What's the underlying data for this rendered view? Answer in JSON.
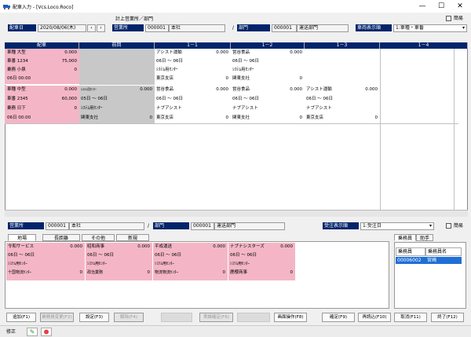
{
  "window": {
    "title": "配車入力 - [Vcs.Loco.Roco]",
    "min_icon": "minimize-icon",
    "max_icon": "maximize-icon",
    "close_icon": "close-icon"
  },
  "header": {
    "small_label": "簡易",
    "date_label": "配車日",
    "date_value": "2020/08/06(木)",
    "billing_title": "計上営業所／部門",
    "office_label": "営業所",
    "office_code": "000001",
    "office_name": "本社",
    "slash": "/",
    "dept_label": "部門",
    "dept_code": "000001",
    "dept_name": "運送部門",
    "vehicle_label": "車両表示順",
    "vehicle_value": "1:車種・車番"
  },
  "grid": {
    "headers": [
      "配車",
      "前回",
      "1－1",
      "1－2",
      "1－3",
      "1－4"
    ],
    "rows": [
      {
        "vehicle": {
          "type": "車種  大型",
          "number": "車番  1234",
          "number_val": "75,000",
          "driver": "乗務  小泉",
          "driver_val": "0",
          "date": "06日  00:00",
          "top_val": "0.000"
        },
        "prev": null,
        "slots": [
          {
            "dest": "アシスト運輸",
            "weight": "0.000",
            "dates": "06日  ～ 06日",
            "center": "ｼｽﾃﾑ用ｾﾝﾀｰ",
            "branch": "東京支店",
            "amt": "0"
          },
          {
            "dest": "営谷食品",
            "weight": "0.000",
            "dates": "06日  ～ 06日",
            "center": "ｼｽﾃﾑ用ｾﾝﾀｰ",
            "branch": "関東支社",
            "amt": "0"
          },
          null,
          null
        ]
      },
      {
        "vehicle": {
          "type": "車種  中型",
          "number": "車番  2345",
          "number_val": "60,000",
          "driver": "乗務  日下",
          "driver_val": "0",
          "date": "06日  00:00",
          "top_val": "0.000"
        },
        "prev": {
          "dest": "ｼｽﾃﾑ用ｾﾝﾀｰ",
          "weight": "0.000",
          "dates": "05日  ～ 06日",
          "center": "ｼｽﾃﾑ用ｾﾝﾀｰ",
          "branch": "関東支社",
          "amt": "0"
        },
        "slots": [
          {
            "dest": "営谷食品",
            "weight": "0.000",
            "dates": "06日  ～ 06日",
            "center": "ナブアシスト",
            "branch": "東京支店",
            "amt": "0"
          },
          {
            "dest": "営谷食品",
            "weight": "0.000",
            "dates": "06日  ～ 06日",
            "center": "ナブアシスト",
            "branch": "関東支社",
            "amt": "0"
          },
          {
            "dest": "アシスト運輸",
            "weight": "0.000",
            "dates": "06日  ～ 06日",
            "center": "ナブアシスト",
            "branch": "東京支店",
            "amt": "0"
          },
          null
        ]
      }
    ]
  },
  "lower": {
    "office_label": "営業所",
    "office_code": "000001",
    "office_name": "本社",
    "slash": "/",
    "dept_label": "部門",
    "dept_code": "000001",
    "dept_name": "運送部門",
    "order_label": "受注表示順",
    "order_value": "1:受注日",
    "small_label": "簡易",
    "tabs": [
      "地場",
      "長距離",
      "その他",
      "新規"
    ],
    "orders": [
      [
        {
          "name": "令和サービス",
          "val": "0.000",
          "dates": "06日  ～ 06日",
          "center": "ｼｽﾃﾑ用ｾﾝﾀｰ",
          "branch": "十国物流ｾﾝﾀｰ",
          "amt": "0"
        },
        {
          "name": "昭和商事",
          "val": "0.000",
          "dates": "06日  ～ 06日",
          "center": "ｼｽﾃﾑ用ｾﾝﾀｰ",
          "branch": "政治業務",
          "amt": "0"
        },
        {
          "name": "平成運送",
          "val": "0.000",
          "dates": "06日  ～ 06日",
          "center": "ｼｽﾃﾑ用ｾﾝﾀｰ",
          "branch": "物流物流ｾﾝﾀｰ",
          "amt": "0"
        },
        {
          "name": "ナブナシスターズ",
          "val": "0.000",
          "dates": "06日  ～ 06日",
          "center": "ｼｽﾃﾑ用ｾﾝﾀｰ",
          "branch": "鹿櫻商事",
          "amt": "0"
        }
      ]
    ],
    "crew_tabs": [
      "乗務員",
      "助手"
    ],
    "crew_headers": [
      "乗務員",
      "乗務員名"
    ],
    "crew_rows": [
      {
        "code": "00006002",
        "name": "宮崎"
      }
    ]
  },
  "fkeys": [
    {
      "label": "追加(F1)",
      "state": "on"
    },
    {
      "label": "乗務員変更(F2)",
      "state": "dis"
    },
    {
      "label": "設定(F3)",
      "state": "on"
    },
    {
      "label": "解除(F4)",
      "state": "dis"
    },
    {
      "label": "",
      "state": "blank"
    },
    {
      "label": "実績確定(F6)",
      "state": "dis"
    },
    {
      "label": "",
      "state": "blank"
    },
    {
      "label": "画面操作(F8)",
      "state": "on"
    },
    {
      "label": "確定(F9)",
      "state": "on"
    },
    {
      "label": "再読込(F10)",
      "state": "on"
    },
    {
      "label": "取消(F11)",
      "state": "on"
    },
    {
      "label": "終了(F12)",
      "state": "on"
    }
  ],
  "status": {
    "mode": "修正"
  }
}
